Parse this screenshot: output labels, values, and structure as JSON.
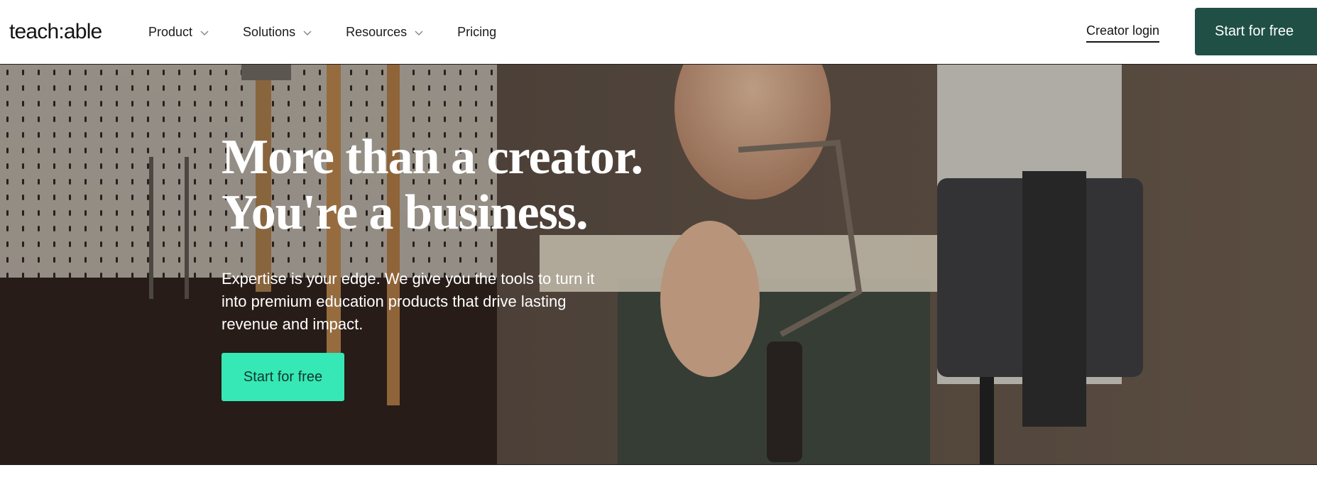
{
  "brand": {
    "logo_text": "teach:able"
  },
  "nav": {
    "items": [
      {
        "label": "Product",
        "has_dropdown": true
      },
      {
        "label": "Solutions",
        "has_dropdown": true
      },
      {
        "label": "Resources",
        "has_dropdown": true
      },
      {
        "label": "Pricing",
        "has_dropdown": false
      }
    ],
    "creator_login": "Creator login",
    "cta_label": "Start for free"
  },
  "hero": {
    "title_line1": "More than a creator.",
    "title_line2": "You're a business.",
    "subtitle": "Expertise is your edge. We give you the tools to turn it into premium education products that drive lasting revenue and impact.",
    "cta_label": "Start for free"
  },
  "colors": {
    "header_cta_bg": "#1f4f45",
    "hero_cta_bg": "#35e8b6",
    "text_dark": "#1a1a1a"
  },
  "icons": [
    "chevron-down-icon"
  ]
}
